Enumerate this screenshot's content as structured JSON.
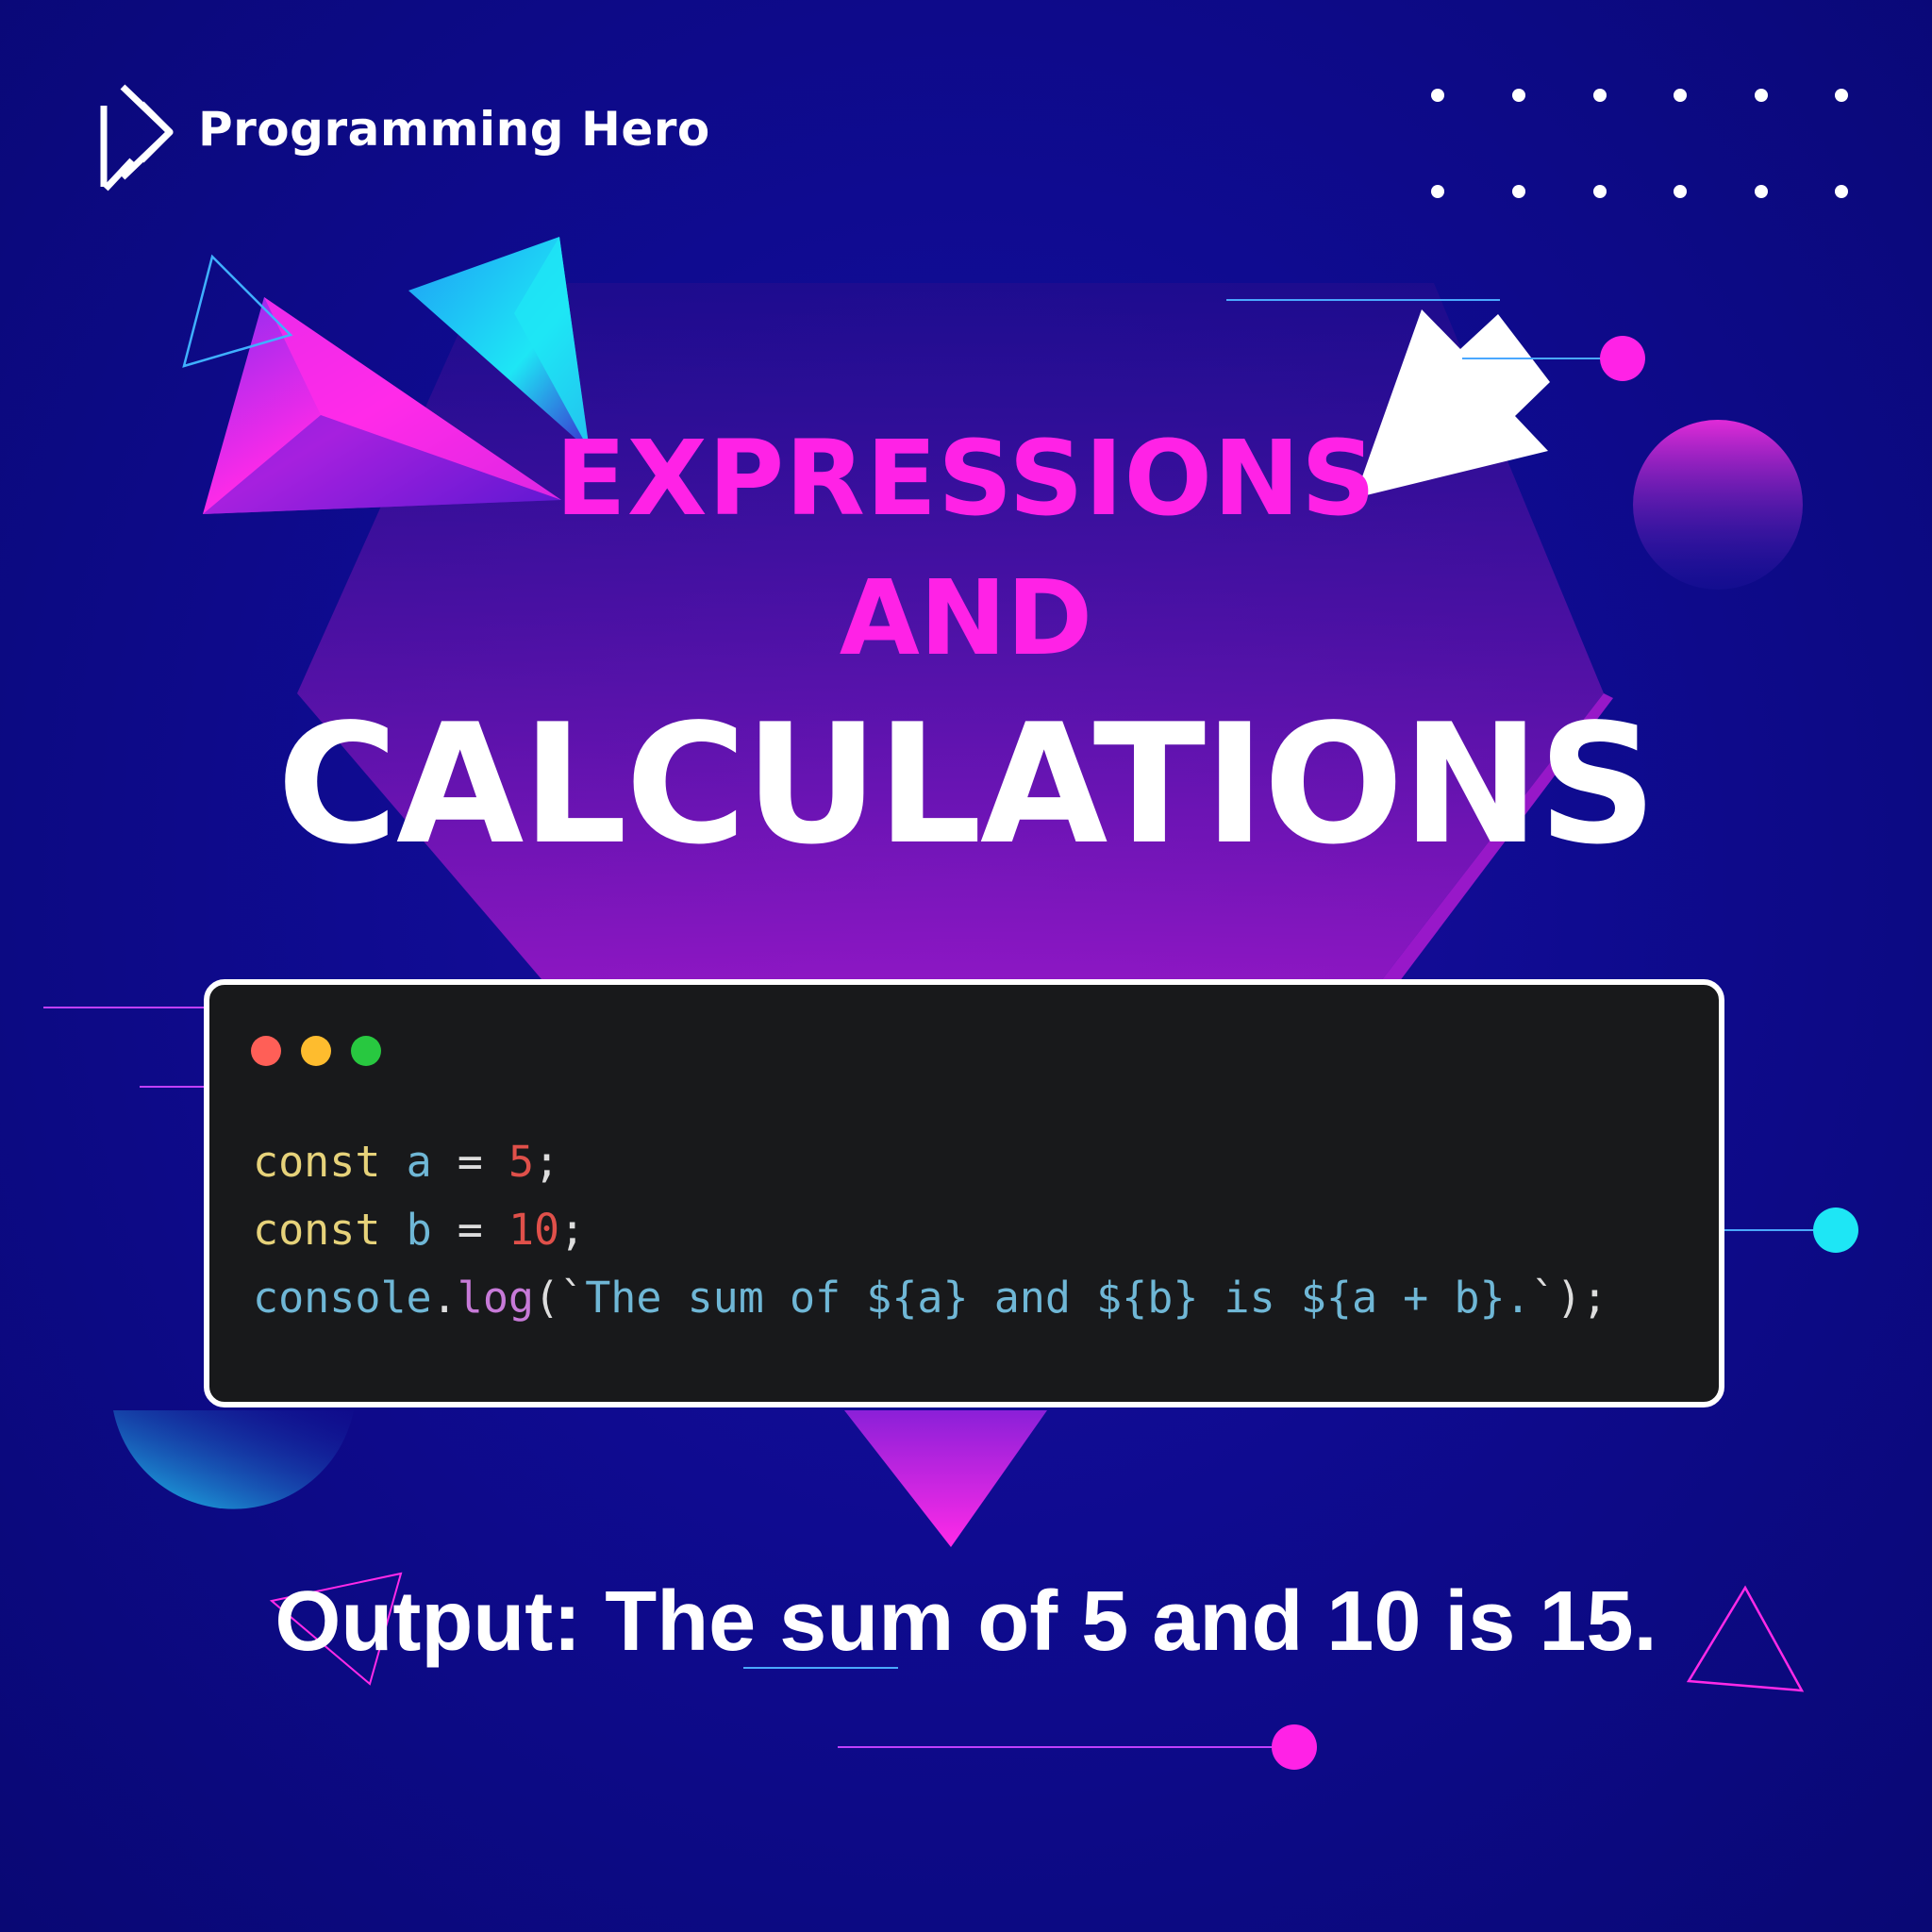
{
  "brand": {
    "name": "Programming Hero",
    "logo_icon": "play-chevron-logo"
  },
  "title": {
    "line1": "EXPRESSIONS",
    "line2": "AND",
    "line3": "CALCULATIONS"
  },
  "code_window": {
    "lines": [
      {
        "tokens": [
          {
            "text": "const",
            "kind": "kw"
          },
          {
            "text": " ",
            "kind": "op"
          },
          {
            "text": "a",
            "kind": "var"
          },
          {
            "text": " = ",
            "kind": "op"
          },
          {
            "text": "5",
            "kind": "num"
          },
          {
            "text": ";",
            "kind": "op"
          }
        ]
      },
      {
        "tokens": [
          {
            "text": "const",
            "kind": "kw"
          },
          {
            "text": " ",
            "kind": "op"
          },
          {
            "text": "b",
            "kind": "var"
          },
          {
            "text": " = ",
            "kind": "op"
          },
          {
            "text": "10",
            "kind": "num"
          },
          {
            "text": ";",
            "kind": "op"
          }
        ]
      },
      {
        "tokens": [
          {
            "text": "console",
            "kind": "var"
          },
          {
            "text": ".",
            "kind": "op"
          },
          {
            "text": "log",
            "kind": "fn"
          },
          {
            "text": "(`",
            "kind": "op"
          },
          {
            "text": "The sum of ${a} and ${b} is ${a + b}.",
            "kind": "str"
          },
          {
            "text": "`);",
            "kind": "op"
          }
        ]
      }
    ]
  },
  "output": "Output: The sum of 5 and 10 is 15.",
  "colors": {
    "background": "#0f0b90",
    "accent_magenta": "#ff22e6",
    "accent_cyan": "#1ee6f5",
    "code_bg": "#18191b"
  }
}
